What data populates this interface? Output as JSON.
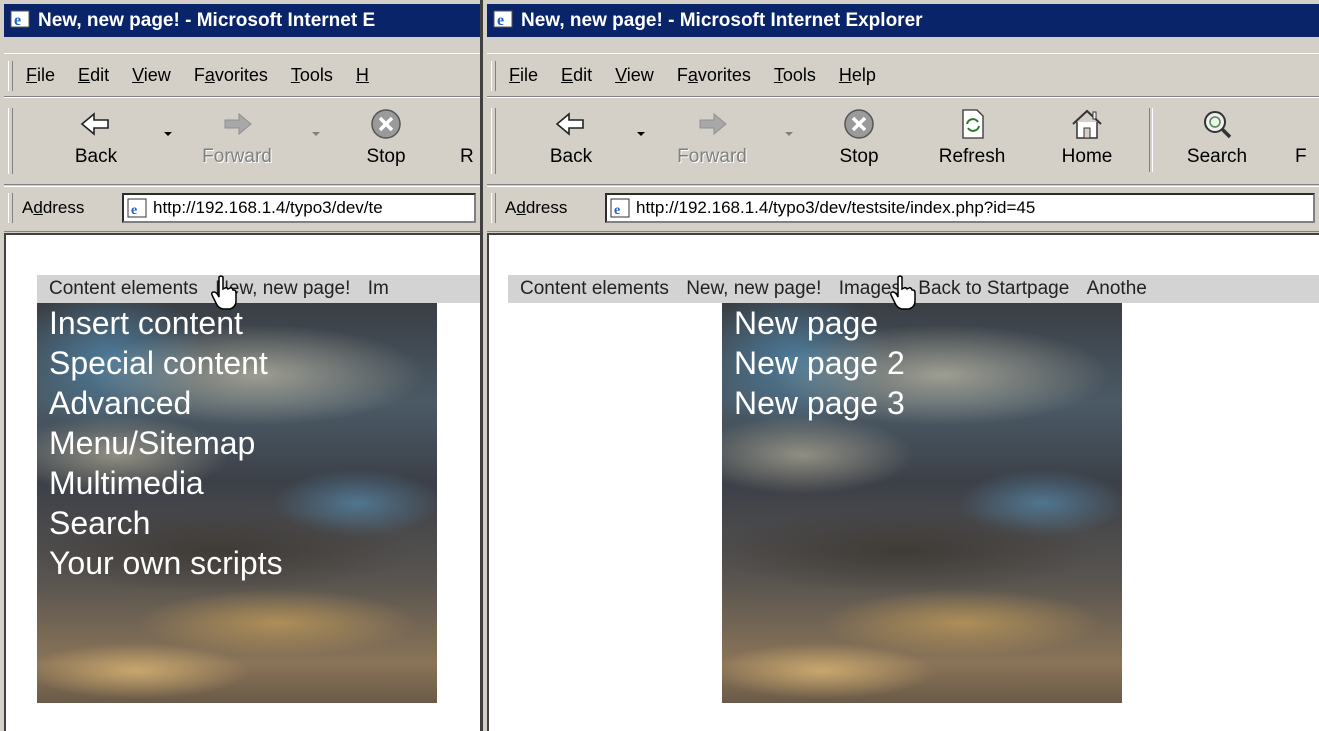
{
  "left": {
    "title": "New, new page! - Microsoft Internet E",
    "menu": [
      "File",
      "Edit",
      "View",
      "Favorites",
      "Tools",
      "H"
    ],
    "menu_access": [
      "F",
      "E",
      "V",
      "a",
      "T",
      "H"
    ],
    "toolbar": {
      "back": "Back",
      "forward": "Forward",
      "stop": "Stop",
      "refresh": "R"
    },
    "address_label": "Address",
    "address_access": "d",
    "url": "http://192.168.1.4/typo3/dev/te",
    "nav": [
      "Content elements",
      "New, new page!",
      "Im"
    ],
    "submenu": [
      "Insert content",
      "Special content",
      "Advanced",
      "Menu/Sitemap",
      "Multimedia",
      "Search",
      "Your own scripts"
    ]
  },
  "right": {
    "title": "New, new page! - Microsoft Internet Explorer",
    "menu": [
      "File",
      "Edit",
      "View",
      "Favorites",
      "Tools",
      "Help"
    ],
    "menu_access": [
      "F",
      "E",
      "V",
      "a",
      "T",
      "H"
    ],
    "toolbar": {
      "back": "Back",
      "forward": "Forward",
      "stop": "Stop",
      "refresh": "Refresh",
      "home": "Home",
      "search": "Search",
      "more": "F"
    },
    "address_label": "Address",
    "address_access": "d",
    "url": "http://192.168.1.4/typo3/dev/testsite/index.php?id=45",
    "nav": [
      "Content elements",
      "New, new page!",
      "Images",
      "Back to Startpage",
      "Anothe"
    ],
    "submenu": [
      "New page",
      "New page 2",
      "New page 3"
    ]
  },
  "colors": {
    "titlebar": "#0a246a",
    "chrome": "#d4d0c8",
    "navbar": "#d3d3d3"
  },
  "icons": [
    "ie-logo-icon",
    "back-arrow-icon",
    "forward-arrow-icon",
    "stop-icon",
    "refresh-icon",
    "home-icon",
    "search-icon",
    "page-icon",
    "hand-cursor-icon"
  ]
}
